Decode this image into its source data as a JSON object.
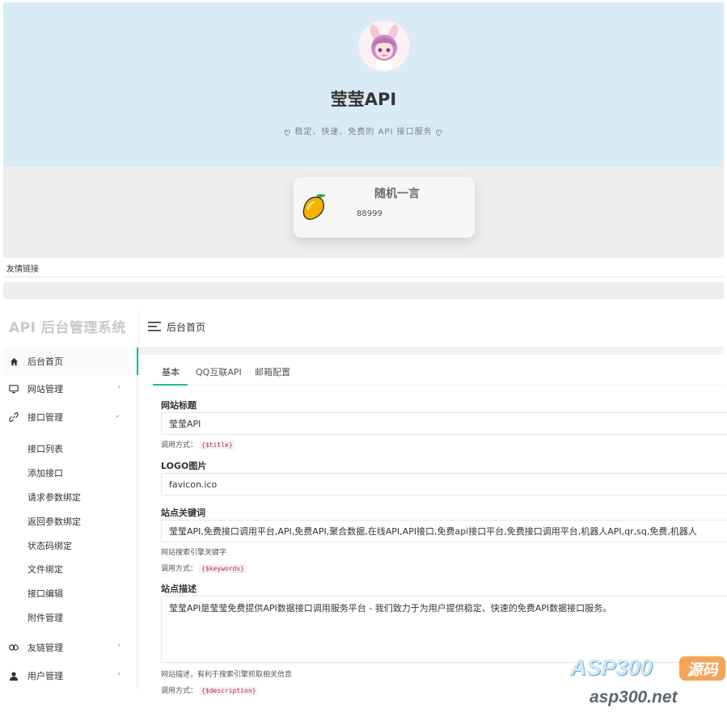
{
  "site": {
    "title": "莹莹API",
    "subtitle": "ღ 稳定、快速、免费的 API 接口服务 ღ"
  },
  "quote": {
    "title": "随机一言",
    "text": "88999"
  },
  "links": {
    "label": "友情链接"
  },
  "admin": {
    "brand": "API 后台管理系统",
    "topbar_title": "后台首页",
    "menu": [
      {
        "label": "后台首页",
        "icon": "home-icon"
      },
      {
        "label": "网站管理",
        "icon": "monitor-icon"
      },
      {
        "label": "接口管理",
        "icon": "link-icon"
      },
      {
        "label": "友链管理",
        "icon": "chain-icon"
      },
      {
        "label": "用户管理",
        "icon": "user-icon"
      }
    ],
    "submenu": [
      "接口列表",
      "添加接口",
      "请求参数绑定",
      "返回参数绑定",
      "状态码绑定",
      "文件绑定",
      "接口编辑",
      "附件管理"
    ],
    "tabs": [
      "基本",
      "QQ互联API",
      "邮箱配置"
    ],
    "form": {
      "site_title_label": "网站标题",
      "site_title_value": "莹莹API",
      "usage_prefix": "调用方式：",
      "title_code": "{$title}",
      "logo_label": "LOGO图片",
      "logo_value": "favicon.ico",
      "keywords_label": "站点关键词",
      "keywords_value": "莹莹API,免费接口调用平台,API,免费API,聚合数据,在线API,API接口,免费api接口平台,免费接口调用平台,机器人API,qr,sq,免费,机器人",
      "keywords_hint": "网站搜索引擎关键字",
      "keywords_code": "{$keywords}",
      "desc_label": "站点描述",
      "desc_value": "莹莹API是莹莹免费提供API数据接口调用服务平台 - 我们致力于为用户提供稳定、快速的免费API数据接口服务。",
      "desc_hint": "网站描述，有利于搜索引擎抓取相关信息",
      "desc_code": "{$description}"
    }
  },
  "watermark": {
    "main": "ASP300",
    "badge": "源码",
    "url": "asp300.net"
  },
  "colors": {
    "accent": "#1abc9c",
    "hero_bg": "#d9ecf6",
    "code_red": "#c7254e"
  }
}
